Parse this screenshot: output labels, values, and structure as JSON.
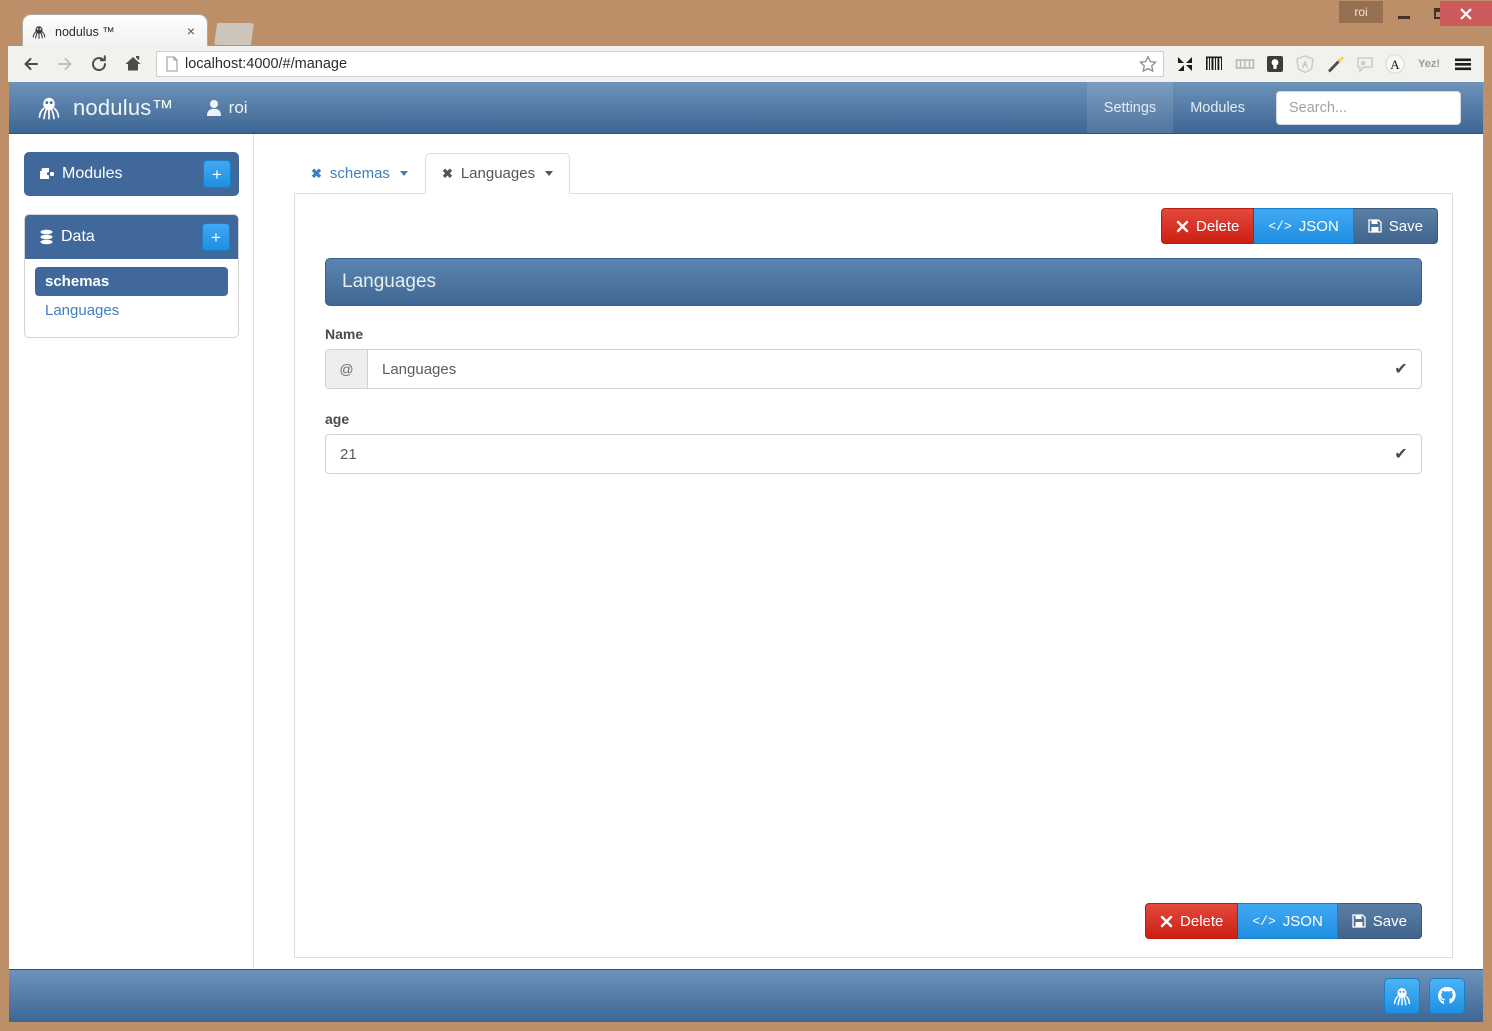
{
  "os_window": {
    "user_label": "roi",
    "minimize_label": "Minimize",
    "maximize_label": "Maximize",
    "close_label": "Close"
  },
  "browser": {
    "tab": {
      "title": "nodulus ™",
      "favicon": "octopus-favicon",
      "close_label": "×"
    },
    "new_tab_label": "New tab",
    "toolbar": {
      "back_label": "Back",
      "forward_label": "Forward",
      "reload_label": "Reload",
      "home_label": "Home"
    },
    "url": "localhost:4000/#/manage",
    "bookmark_icon": "star-icon",
    "extensions": [
      {
        "name": "shuffle-icon",
        "glyph": "⤨"
      },
      {
        "name": "barcode-icon",
        "glyph": "⦀"
      },
      {
        "name": "ruler-icon",
        "glyph": "▤"
      },
      {
        "name": "lightbulb-icon",
        "glyph": "Ὂ1"
      },
      {
        "name": "angular-icon",
        "glyph": "A"
      },
      {
        "name": "magic-wand-icon",
        "glyph": "✦"
      },
      {
        "name": "speech-bubble-icon",
        "glyph": "▢"
      },
      {
        "name": "font-a-icon",
        "glyph": "A"
      }
    ],
    "yez_label": "Yez!",
    "menu_label": "Customize and control"
  },
  "app": {
    "brand": {
      "name": "nodulus™",
      "logo": "octopus-logo"
    },
    "user": {
      "name": "roi",
      "icon": "user-icon"
    },
    "nav_links": [
      {
        "label": "Settings",
        "active": true
      },
      {
        "label": "Modules",
        "active": false
      }
    ],
    "search": {
      "value": "",
      "placeholder": "Search..."
    }
  },
  "sidebar": {
    "modules_panel": {
      "title": "Modules",
      "icon": "puzzle-piece-icon",
      "add_label": "+"
    },
    "data_panel": {
      "title": "Data",
      "icon": "database-icon",
      "add_label": "+",
      "items": [
        {
          "label": "schemas",
          "active": true
        },
        {
          "label": "Languages",
          "active": false
        }
      ]
    }
  },
  "main": {
    "tabs": [
      {
        "label": "schemas",
        "active": false,
        "close": "✖",
        "caret": true
      },
      {
        "label": "Languages",
        "active": true,
        "close": "✖",
        "caret": true
      }
    ],
    "actions": [
      {
        "name": "delete-button",
        "label": "Delete",
        "icon": "x-icon",
        "style": "danger"
      },
      {
        "name": "json-button",
        "label": "JSON",
        "icon": "code-icon",
        "style": "info"
      },
      {
        "name": "save-button",
        "label": "Save",
        "icon": "floppy-disk-icon",
        "style": "save"
      }
    ],
    "record_title": "Languages",
    "fields": [
      {
        "label": "Name",
        "addon": "@",
        "value": "Languages",
        "valid": true,
        "check": "✔"
      },
      {
        "label": "age",
        "addon": null,
        "value": "21",
        "valid": true,
        "check": "✔"
      }
    ]
  },
  "footer": {
    "icons": [
      {
        "name": "octopus-icon"
      },
      {
        "name": "github-icon"
      }
    ]
  },
  "colors": {
    "brand_blue": "#41689a",
    "navbar_top": "#6d93b9",
    "navbar_bottom": "#3c6694",
    "danger_red": "#cc1f12",
    "info_blue": "#1e8fe0",
    "link_blue": "#3f7fbf",
    "window_chrome": "#bd8f68"
  }
}
